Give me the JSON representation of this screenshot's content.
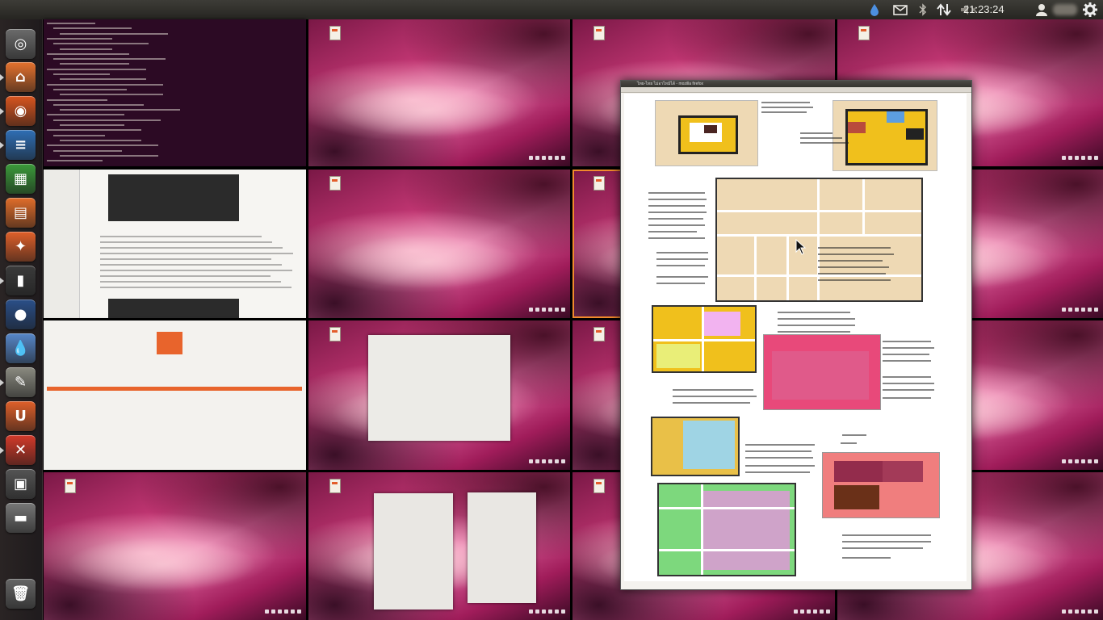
{
  "panel": {
    "clock": "21:23:24",
    "indicators": [
      "ubuntu-one-icon",
      "mail-icon",
      "bluetooth-icon",
      "network-icon",
      "volume-muted-icon",
      "user-icon",
      "session-gear-icon"
    ]
  },
  "launcher": {
    "items": [
      {
        "name": "dash-home",
        "icon": "ubuntu-logo-icon",
        "color": "#6b6b6b",
        "glyph": "◎"
      },
      {
        "name": "files",
        "icon": "home-folder-icon",
        "color": "#e5722e",
        "glyph": "⌂"
      },
      {
        "name": "firefox",
        "icon": "firefox-icon",
        "color": "#d8551f",
        "glyph": "◉"
      },
      {
        "name": "writer",
        "icon": "libreoffice-writer-icon",
        "color": "#2f6fb5",
        "glyph": "≡"
      },
      {
        "name": "calc",
        "icon": "libreoffice-calc-icon",
        "color": "#3b9a3a",
        "glyph": "▦"
      },
      {
        "name": "impress",
        "icon": "libreoffice-impress-icon",
        "color": "#e06d2a",
        "glyph": "▤"
      },
      {
        "name": "software-center",
        "icon": "software-center-icon",
        "color": "#e0602a",
        "glyph": "✦"
      },
      {
        "name": "terminal",
        "icon": "terminal-icon",
        "color": "#3b3b3b",
        "glyph": "▮"
      },
      {
        "name": "earth",
        "icon": "globe-icon",
        "color": "#2a4f88",
        "glyph": "●"
      },
      {
        "name": "ubuntu-one",
        "icon": "ubuntu-one-icon",
        "color": "#5787c8",
        "glyph": "💧"
      },
      {
        "name": "gimp",
        "icon": "gimp-icon",
        "color": "#8a8a80",
        "glyph": "✎"
      },
      {
        "name": "ubuntu-one-music",
        "icon": "ubuntu-one-u-icon",
        "color": "#e0602a",
        "glyph": "U"
      },
      {
        "name": "system-settings",
        "icon": "settings-icon",
        "color": "#d33a2a",
        "glyph": "✕"
      },
      {
        "name": "workspace-switcher",
        "icon": "workspace-switcher-icon",
        "color": "#555",
        "glyph": "▣"
      },
      {
        "name": "disk",
        "icon": "drive-icon",
        "color": "#777",
        "glyph": "▬"
      },
      {
        "name": "trash",
        "icon": "trash-icon",
        "color": "#666",
        "glyph": "🗑"
      }
    ]
  },
  "workspaces": {
    "count": 16,
    "active_index": 6
  },
  "document_window": {
    "title": "ไทย-ไทย ไม่อาไหม้ได้  - mozilla firefox"
  }
}
